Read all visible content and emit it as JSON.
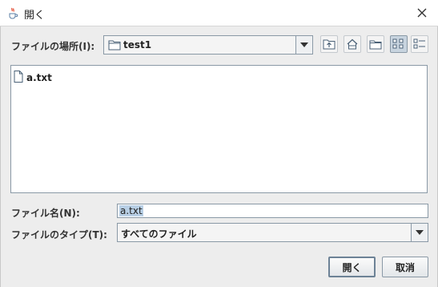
{
  "window": {
    "title": "開く",
    "app_icon": "java-cup-icon",
    "close_icon": "close-icon"
  },
  "look_in": {
    "label": "ファイルの場所(I):",
    "value": "test1",
    "folder_icon": "folder-icon"
  },
  "toolbar": {
    "buttons": [
      {
        "name": "up-one-level-button",
        "icon": "folder-up-icon"
      },
      {
        "name": "home-button",
        "icon": "home-icon"
      },
      {
        "name": "new-folder-button",
        "icon": "new-folder-icon"
      },
      {
        "name": "list-view-button",
        "icon": "list-view-icon",
        "pressed": true
      },
      {
        "name": "details-view-button",
        "icon": "details-view-icon"
      }
    ]
  },
  "files": [
    {
      "name": "a.txt",
      "icon": "file-icon"
    }
  ],
  "filename": {
    "label": "ファイル名(N):",
    "value": "a.txt"
  },
  "filetype": {
    "label": "ファイルのタイプ(T):",
    "value": "すべてのファイル"
  },
  "buttons": {
    "open": "開く",
    "cancel": "取消"
  }
}
